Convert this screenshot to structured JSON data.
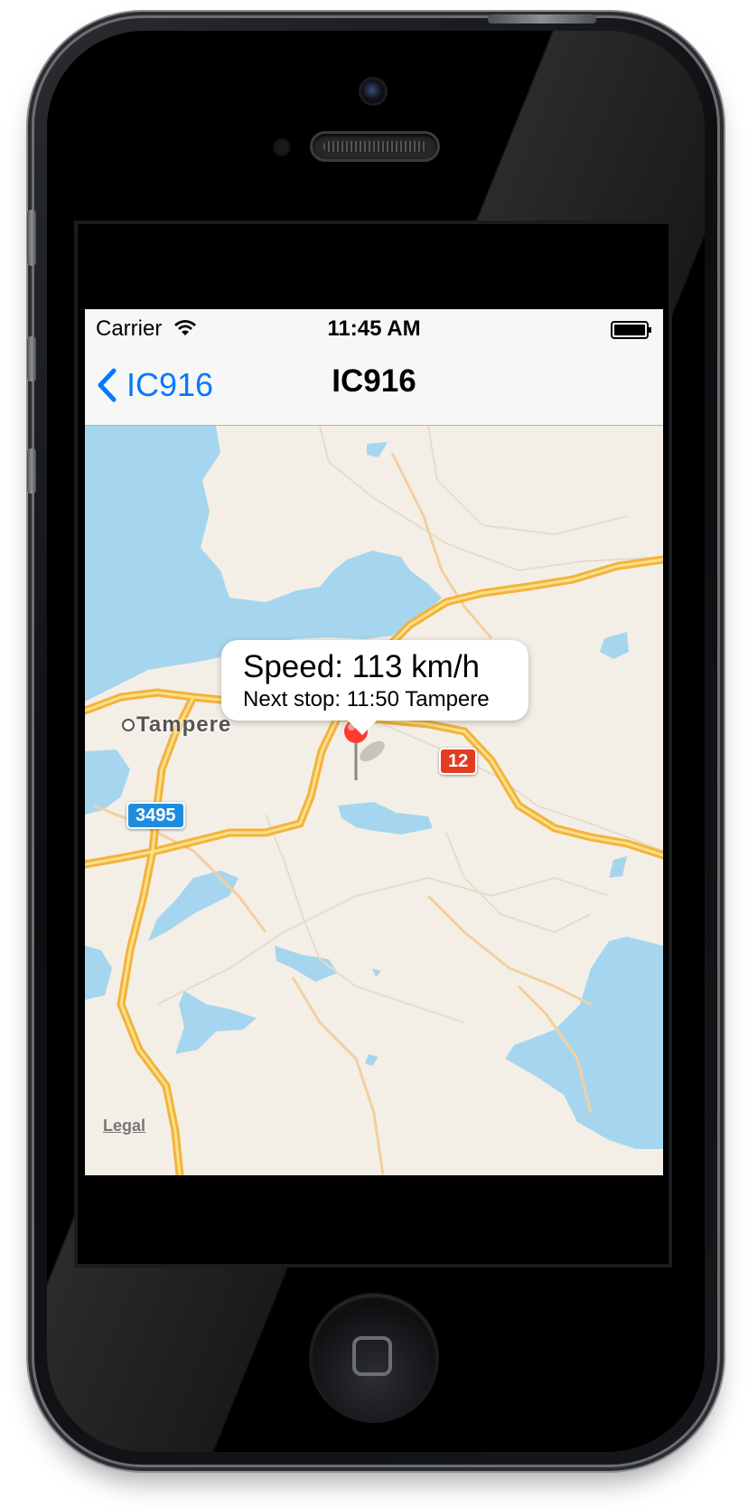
{
  "status_bar": {
    "carrier": "Carrier",
    "time": "11:45 AM"
  },
  "nav_bar": {
    "back_label": "IC916",
    "title": "IC916",
    "accent_color": "#007aff"
  },
  "map": {
    "city_label": "Tampere",
    "road_shield_blue": "3495",
    "road_shield_red": "12",
    "legal_label": "Legal",
    "water_color": "#a6d6ef",
    "land_color": "#f4efe6",
    "road_color": "#f7c23c"
  },
  "annotation": {
    "title": "Speed: 113 km/h",
    "subtitle": "Next stop: 11:50 Tampere",
    "pin_color": "#ff3b30"
  }
}
